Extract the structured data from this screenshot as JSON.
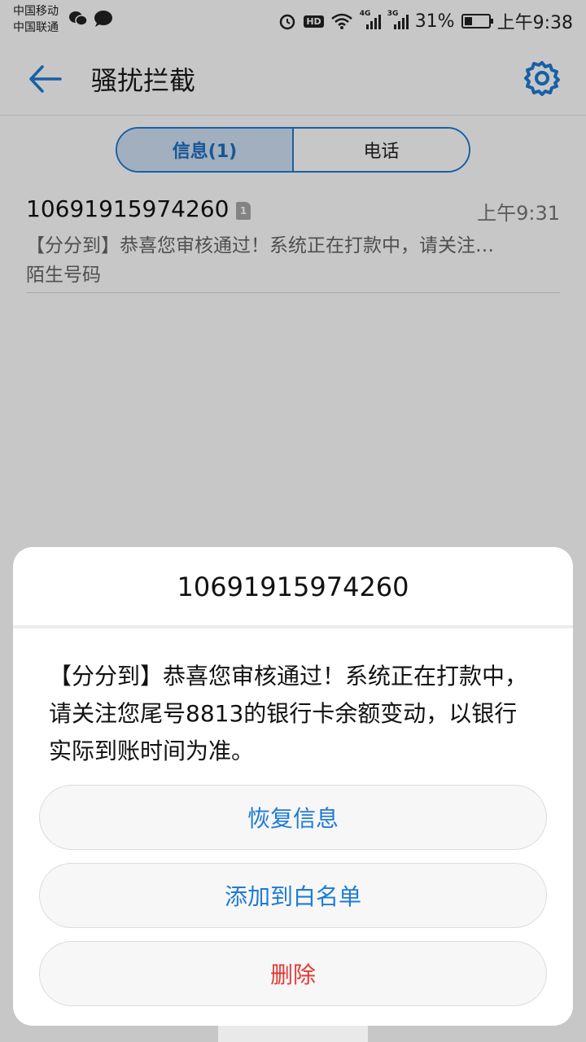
{
  "statusbar": {
    "carrier1": "中国移动",
    "carrier2": "中国联通",
    "left_icons": [
      "wechat-icon",
      "chat-bubble-icon"
    ],
    "hd_label": "HD",
    "net1_label": "4G",
    "net2_label": "3G",
    "battery_percent": "31%",
    "battery_level": 0.31,
    "time": "上午9:38"
  },
  "appbar": {
    "title": "骚扰拦截",
    "back_icon": "back-arrow-icon",
    "settings_icon": "gear-icon"
  },
  "tabs": [
    {
      "label": "信息(1)",
      "active": true
    },
    {
      "label": "电话",
      "active": false
    }
  ],
  "message": {
    "number": "10691915974260",
    "sim": "1",
    "time": "上午9:31",
    "preview": "【分分到】恭喜您审核通过！系统正在打款中，请关注…",
    "tag": "陌生号码"
  },
  "dialog": {
    "title": "10691915974260",
    "body": "【分分到】恭喜您审核通过！系统正在打款中，请关注您尾号8813的银行卡余额变动，以银行实际到账时间为准。",
    "restore_label": "恢复信息",
    "whitelist_label": "添加到白名单",
    "delete_label": "删除"
  },
  "colors": {
    "accent": "#1e7bd6",
    "danger": "#e53935"
  }
}
